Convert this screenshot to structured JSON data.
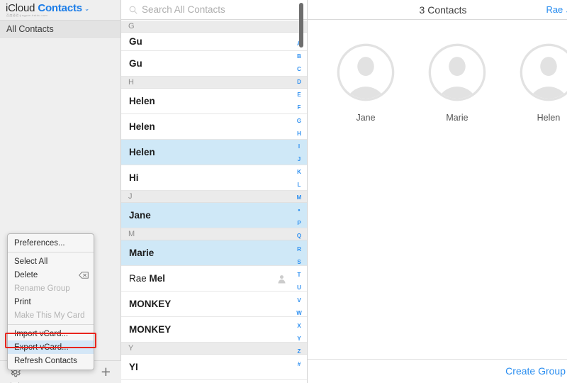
{
  "sidebar": {
    "brand_primary": "iCloud",
    "brand_secondary": "Contacts",
    "brand_chevron": "⌄",
    "watermark": "百度经验:jingyan.baidu.com",
    "group_row_label": "All Contacts",
    "toolbar": {
      "settings_icon": "gear-icon",
      "add_label": "+"
    }
  },
  "context_menu": {
    "items": [
      {
        "label": "Preferences...",
        "disabled": false,
        "highlight": false,
        "glyph": ""
      },
      {
        "label": "Select All",
        "disabled": false,
        "highlight": false,
        "glyph": ""
      },
      {
        "label": "Delete",
        "disabled": false,
        "highlight": false,
        "glyph": "delete-key-icon"
      },
      {
        "label": "Rename Group",
        "disabled": true,
        "highlight": false,
        "glyph": ""
      },
      {
        "label": "Print",
        "disabled": false,
        "highlight": false,
        "glyph": ""
      },
      {
        "label": "Make This My Card",
        "disabled": true,
        "highlight": false,
        "glyph": ""
      },
      {
        "label": "Import vCard...",
        "disabled": false,
        "highlight": false,
        "glyph": ""
      },
      {
        "label": "Export vCard...",
        "disabled": false,
        "highlight": true,
        "glyph": ""
      },
      {
        "label": "Refresh Contacts",
        "disabled": false,
        "highlight": false,
        "glyph": ""
      }
    ],
    "separator_after": [
      0,
      5
    ],
    "highlight_color": "#d4e7f7",
    "annotation_color": "#e8251d"
  },
  "search": {
    "placeholder": "Search All Contacts",
    "value": "",
    "icon": "search-icon"
  },
  "list": {
    "rows": [
      {
        "type": "section",
        "label": "G"
      },
      {
        "type": "contact",
        "first": "Gu",
        "last": "",
        "selected": false,
        "short": true,
        "person_icon": false
      },
      {
        "type": "contact",
        "first": "Gu",
        "last": "",
        "selected": false,
        "short": false,
        "person_icon": false
      },
      {
        "type": "section",
        "label": "H"
      },
      {
        "type": "contact",
        "first": "Helen",
        "last": "",
        "selected": false,
        "short": false,
        "person_icon": false
      },
      {
        "type": "contact",
        "first": "Helen",
        "last": "",
        "selected": false,
        "short": false,
        "person_icon": false
      },
      {
        "type": "contact",
        "first": "Helen",
        "last": "",
        "selected": true,
        "short": false,
        "person_icon": false
      },
      {
        "type": "contact",
        "first": "Hi",
        "last": "",
        "selected": false,
        "short": false,
        "person_icon": false
      },
      {
        "type": "section",
        "label": "J"
      },
      {
        "type": "contact",
        "first": "Jane",
        "last": "",
        "selected": true,
        "short": false,
        "person_icon": false
      },
      {
        "type": "section",
        "label": "M"
      },
      {
        "type": "contact",
        "first": "Marie",
        "last": "",
        "selected": true,
        "short": false,
        "person_icon": false
      },
      {
        "type": "contact",
        "first": "Rae ",
        "last": "Mel",
        "selected": false,
        "short": false,
        "person_icon": true
      },
      {
        "type": "contact",
        "first": "MONKEY",
        "last": "",
        "selected": false,
        "short": false,
        "person_icon": false
      },
      {
        "type": "contact",
        "first": "MONKEY",
        "last": "",
        "selected": false,
        "short": false,
        "person_icon": false
      },
      {
        "type": "section",
        "label": "Y"
      },
      {
        "type": "contact",
        "first": "YI",
        "last": "",
        "selected": false,
        "short": false,
        "person_icon": false
      }
    ],
    "index_letters": [
      "A",
      "B",
      "C",
      "D",
      "E",
      "F",
      "G",
      "H",
      "I",
      "J",
      "K",
      "L",
      "M",
      "•",
      "P",
      "Q",
      "R",
      "S",
      "T",
      "U",
      "V",
      "W",
      "X",
      "Y",
      "Z",
      "#"
    ],
    "selection_color": "#cfe8f7",
    "index_color": "#2b8ef0"
  },
  "detail": {
    "title": "3 Contacts",
    "group_link_label": "Rae",
    "group_link_chevron": "⌄",
    "contacts": [
      {
        "name": "Jane",
        "avatar": "person-placeholder-icon"
      },
      {
        "name": "Marie",
        "avatar": "person-placeholder-icon"
      },
      {
        "name": "Helen",
        "avatar": "person-placeholder-icon"
      }
    ],
    "create_group_label": "Create Group",
    "link_color": "#2b8ef0"
  }
}
